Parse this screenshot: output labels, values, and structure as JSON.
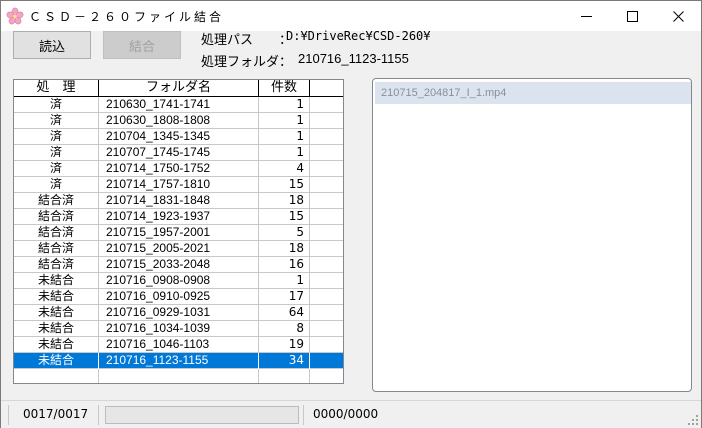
{
  "window": {
    "title": "ＣＳＤ－２６０ファイル結合"
  },
  "toolbar": {
    "load_label": "読込",
    "join_label": "結合"
  },
  "info": {
    "path_label": "処理パス　　：",
    "path_value": "D:¥DriveRec¥CSD-260¥",
    "folder_label": "処理フォルダ：",
    "folder_value": "210716_1123-1155"
  },
  "grid": {
    "headers": {
      "status": "処　理",
      "folder": "フォルダ名",
      "count": "件数"
    },
    "rows": [
      {
        "status": "済",
        "folder": "210630_1741-1741",
        "count": "1"
      },
      {
        "status": "済",
        "folder": "210630_1808-1808",
        "count": "1"
      },
      {
        "status": "済",
        "folder": "210704_1345-1345",
        "count": "1"
      },
      {
        "status": "済",
        "folder": "210707_1745-1745",
        "count": "1"
      },
      {
        "status": "済",
        "folder": "210714_1750-1752",
        "count": "4"
      },
      {
        "status": "済",
        "folder": "210714_1757-1810",
        "count": "15"
      },
      {
        "status": "結合済",
        "folder": "210714_1831-1848",
        "count": "18"
      },
      {
        "status": "結合済",
        "folder": "210714_1923-1937",
        "count": "15"
      },
      {
        "status": "結合済",
        "folder": "210715_1957-2001",
        "count": "5"
      },
      {
        "status": "結合済",
        "folder": "210715_2005-2021",
        "count": "18"
      },
      {
        "status": "結合済",
        "folder": "210715_2033-2048",
        "count": "16"
      },
      {
        "status": "未結合",
        "folder": "210716_0908-0908",
        "count": "1"
      },
      {
        "status": "未結合",
        "folder": "210716_0910-0925",
        "count": "17"
      },
      {
        "status": "未結合",
        "folder": "210716_0929-1031",
        "count": "64"
      },
      {
        "status": "未結合",
        "folder": "210716_1034-1039",
        "count": "8"
      },
      {
        "status": "未結合",
        "folder": "210716_1046-1103",
        "count": "19"
      },
      {
        "status": "未結合",
        "folder": "210716_1123-1155",
        "count": "34"
      },
      {
        "status": "",
        "folder": "",
        "count": ""
      }
    ],
    "selected_index": 16,
    "selection_color": "#0078d7"
  },
  "file_list": {
    "items": [
      "210715_204817_I_1.mp4"
    ]
  },
  "status": {
    "folder_progress": "0017/0017",
    "file_progress": "0000/0000",
    "progress_fraction": 0
  },
  "icons": {
    "app": "cherry-blossom-icon",
    "minimize": "minimize-icon",
    "maximize": "maximize-icon",
    "close": "close-icon",
    "grip": "resize-grip-icon"
  }
}
